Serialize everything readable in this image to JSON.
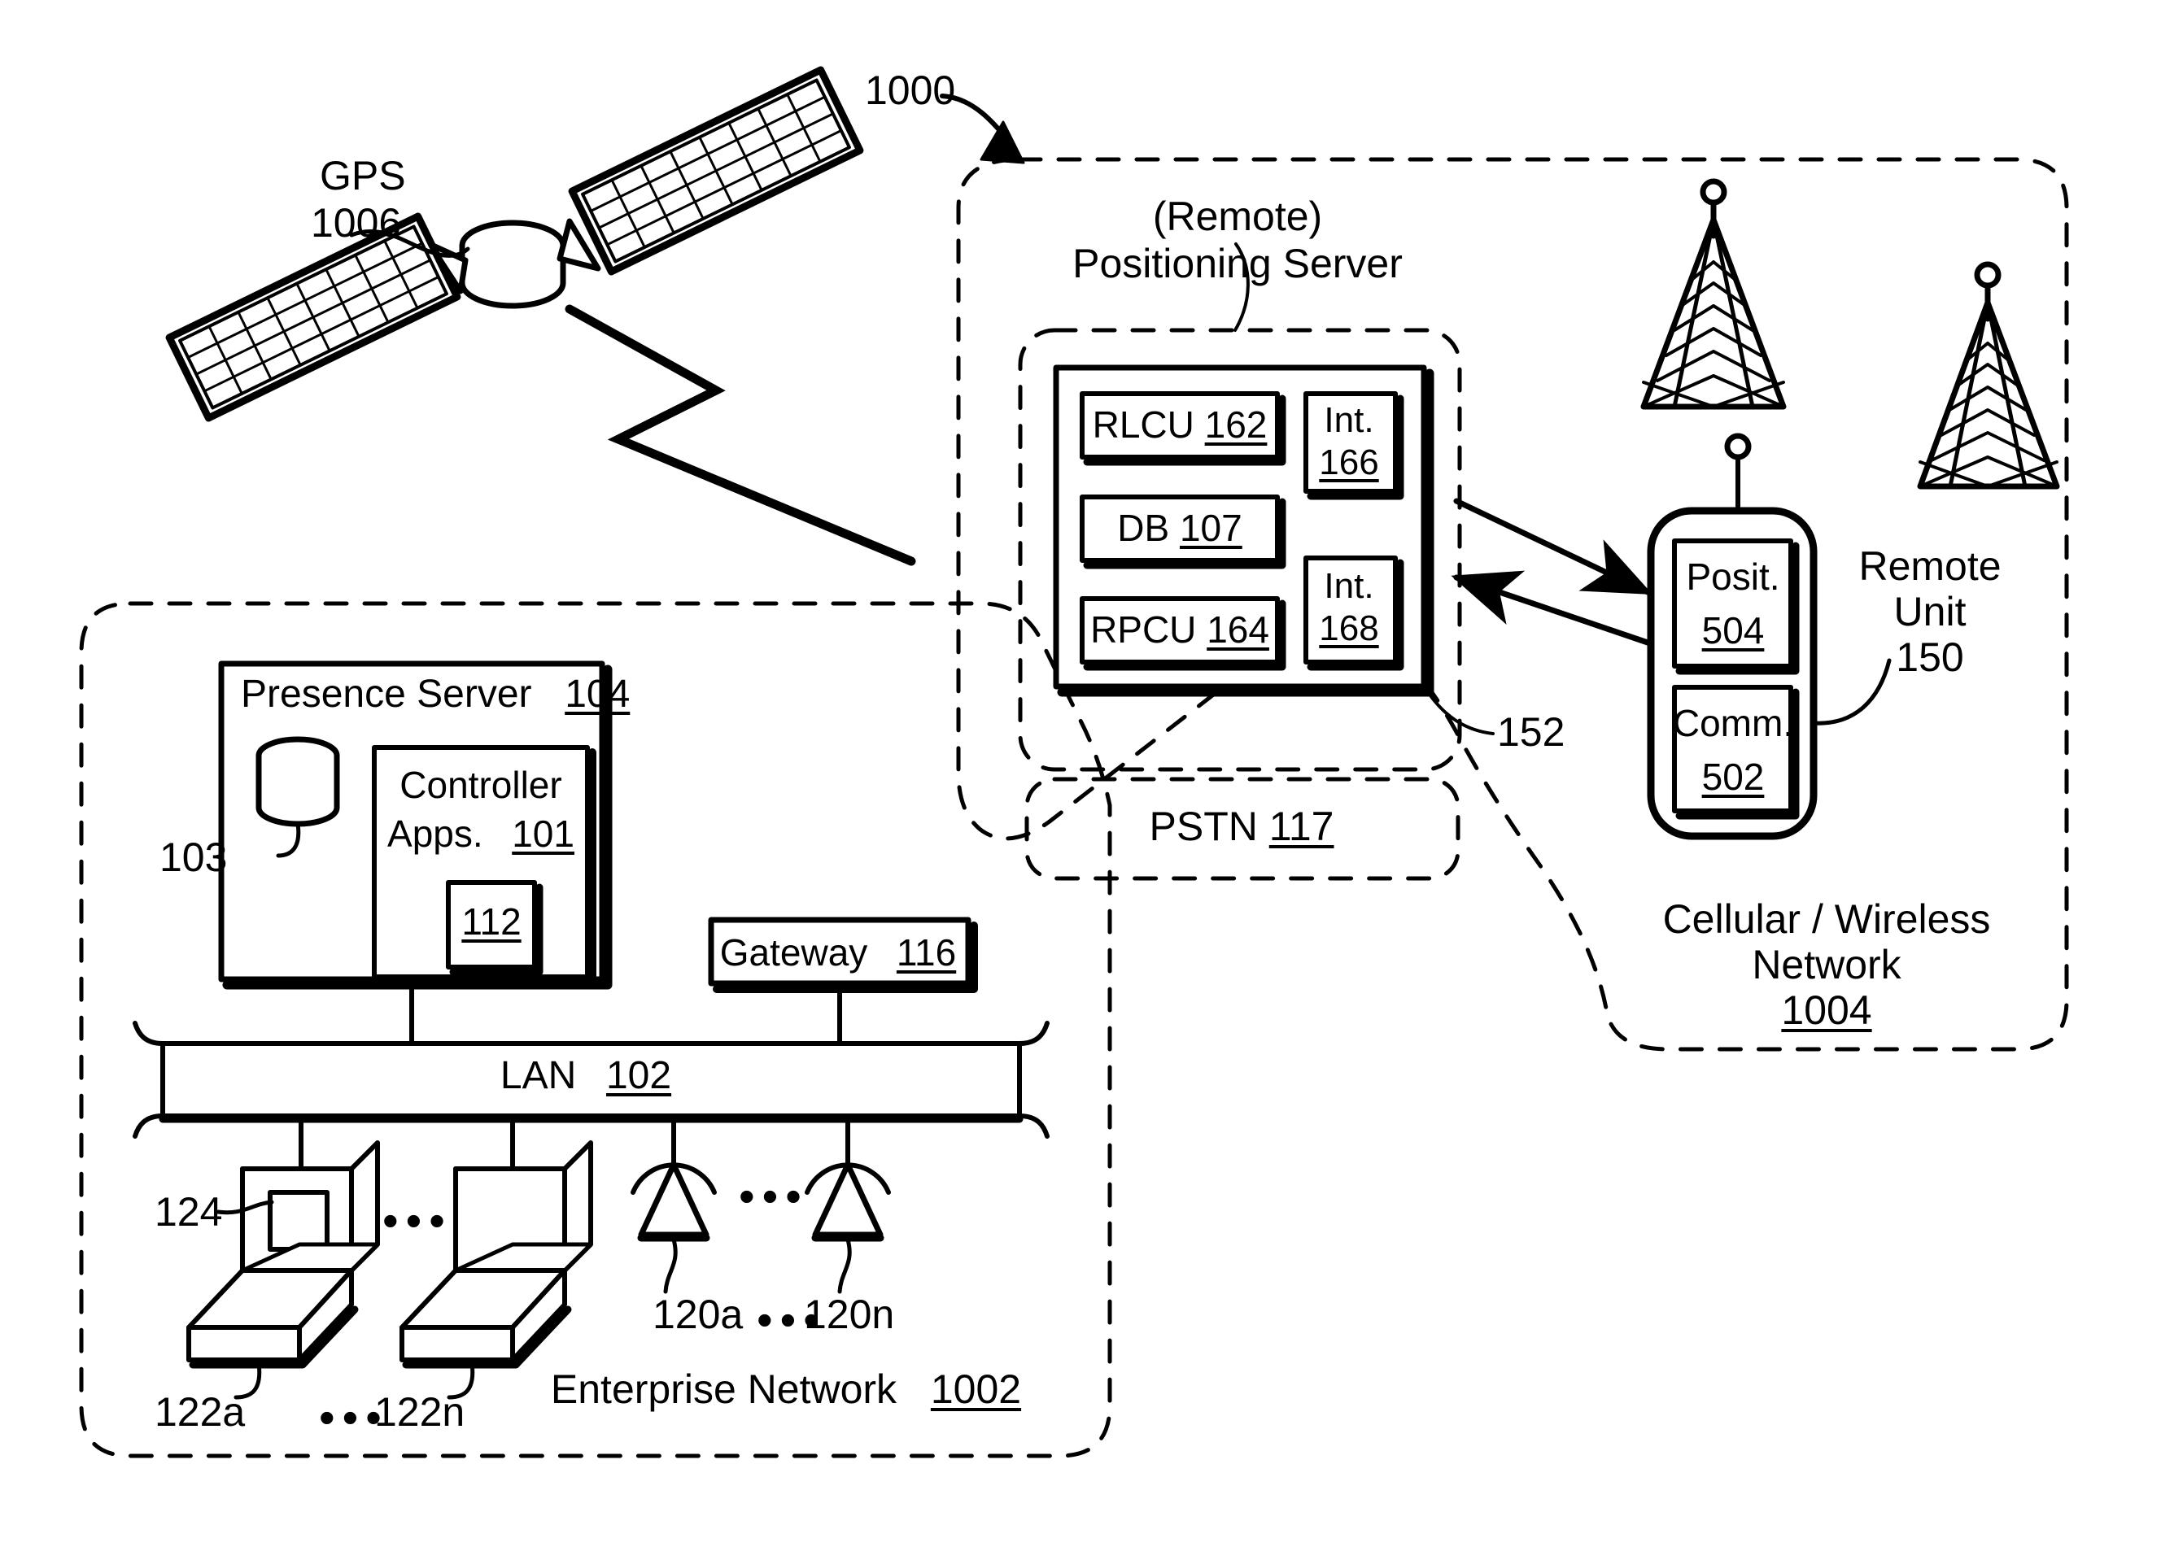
{
  "figure": {
    "title_ref": "1000",
    "gps": {
      "label": "GPS",
      "ref": "1006"
    },
    "positioning_server": {
      "line1": "(Remote)",
      "line2": "Positioning Server",
      "inner_ref": "152",
      "modules": [
        {
          "name": "RLCU",
          "ref": "162"
        },
        {
          "name": "DB",
          "ref": "107"
        },
        {
          "name": "RPCU",
          "ref": "164"
        }
      ],
      "interfaces": [
        {
          "name": "Int.",
          "ref": "166"
        },
        {
          "name": "Int.",
          "ref": "168"
        }
      ]
    },
    "pstn": {
      "label": "PSTN",
      "ref": "117"
    },
    "remote_unit": {
      "label_line1": "Remote",
      "label_line2": "Unit",
      "ref": "150",
      "blocks": [
        {
          "name": "Posit.",
          "ref": "504"
        },
        {
          "name": "Comm.",
          "ref": "502"
        }
      ]
    },
    "cellular_network": {
      "line1": "Cellular / Wireless",
      "line2": "Network",
      "ref": "1004"
    },
    "enterprise_network": {
      "label": "Enterprise Network",
      "ref": "1002",
      "presence_server": {
        "label": "Presence Server",
        "ref": "104",
        "database_ref": "103",
        "controller": {
          "line1": "Controller",
          "line2": "Apps.",
          "ref": "101",
          "inner_ref": "112"
        }
      },
      "gateway": {
        "label": "Gateway",
        "ref": "116"
      },
      "lan": {
        "label": "LAN",
        "ref": "102"
      },
      "computers": {
        "screen_ref": "124",
        "first_ref": "122a",
        "last_ref": "122n",
        "ellipsis": "•••"
      },
      "phones": {
        "first_ref": "120a",
        "last_ref": "120n",
        "ellipsis": "•••"
      }
    }
  },
  "colors": {
    "ink": "#000000",
    "paper": "#ffffff"
  }
}
